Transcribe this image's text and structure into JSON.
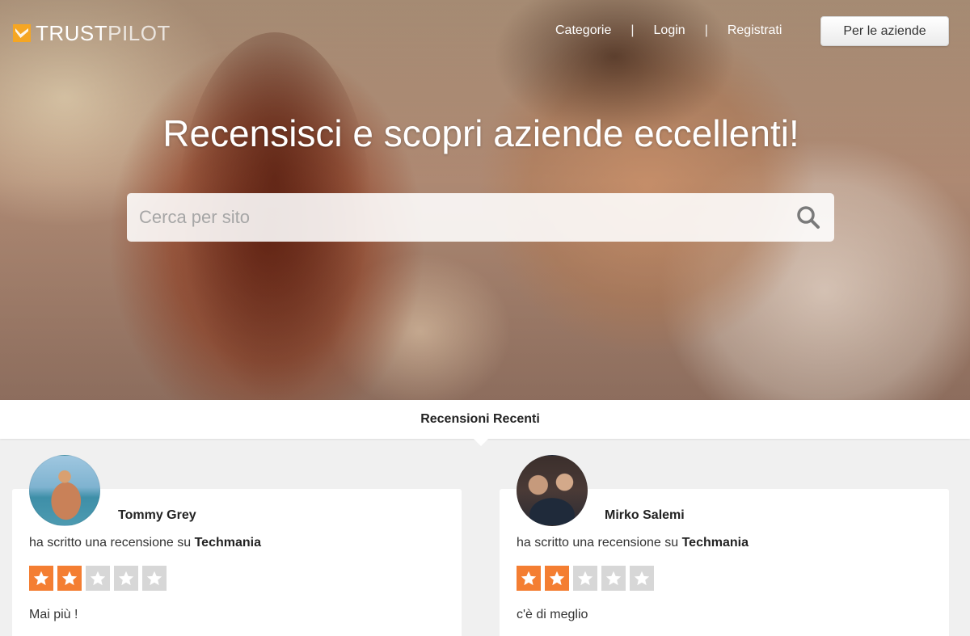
{
  "header": {
    "logo": {
      "part1": "TRUST",
      "part2": "PILOT",
      "icon": "trustpilot-logo-icon"
    },
    "nav": [
      {
        "label": "Categorie"
      },
      {
        "label": "Login"
      },
      {
        "label": "Registrati"
      }
    ],
    "nav_separator": "|",
    "business_button": "Per le aziende"
  },
  "hero": {
    "headline": "Recensisci e scopri aziende eccellenti!",
    "search": {
      "placeholder": "Cerca per sito",
      "value": "",
      "icon": "search-icon"
    }
  },
  "recent": {
    "title": "Recensioni Recenti",
    "reviews": [
      {
        "name": "Tommy Grey",
        "action": "ha scritto una recensione su",
        "company": "Techmania",
        "rating": 2,
        "max_rating": 5,
        "text": "Mai più !"
      },
      {
        "name": "Mirko Salemi",
        "action": "ha scritto una recensione su",
        "company": "Techmania",
        "rating": 2,
        "max_rating": 5,
        "text": "c'è di meglio"
      }
    ]
  },
  "colors": {
    "accent_star": "#f47e32",
    "star_off": "#d7d7d7",
    "logo_accent": "#f5a623"
  }
}
